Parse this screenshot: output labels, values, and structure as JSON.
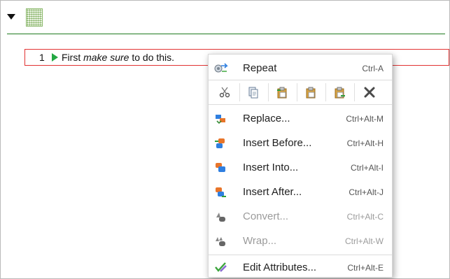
{
  "document": {
    "item": {
      "number": "1",
      "text_before": "First ",
      "text_emphasis": "make sure",
      "text_after": " to do this."
    }
  },
  "context_menu": {
    "repeat": {
      "label": "Repeat",
      "shortcut": "Ctrl-A",
      "icon": "repeat-icon"
    },
    "toolbar": [
      {
        "name": "cut",
        "icon": "scissors-icon"
      },
      {
        "name": "copy",
        "icon": "copy-icon"
      },
      {
        "name": "paste-before",
        "icon": "paste-before-icon"
      },
      {
        "name": "paste",
        "icon": "paste-icon"
      },
      {
        "name": "paste-after",
        "icon": "paste-after-icon"
      },
      {
        "name": "delete",
        "icon": "delete-icon"
      }
    ],
    "items": [
      {
        "label": "Replace...",
        "shortcut": "Ctrl+Alt-M",
        "enabled": true,
        "icon": "replace-icon"
      },
      {
        "label": "Insert Before...",
        "shortcut": "Ctrl+Alt-H",
        "enabled": true,
        "icon": "insert-before-icon"
      },
      {
        "label": "Insert Into...",
        "shortcut": "Ctrl+Alt-I",
        "enabled": true,
        "icon": "insert-into-icon"
      },
      {
        "label": "Insert After...",
        "shortcut": "Ctrl+Alt-J",
        "enabled": true,
        "icon": "insert-after-icon"
      },
      {
        "label": "Convert...",
        "shortcut": "Ctrl+Alt-C",
        "enabled": false,
        "icon": "convert-icon"
      },
      {
        "label": "Wrap...",
        "shortcut": "Ctrl+Alt-W",
        "enabled": false,
        "icon": "wrap-icon"
      }
    ],
    "edit_attributes": {
      "label": "Edit Attributes...",
      "shortcut": "Ctrl+Alt-E",
      "icon": "edit-attributes-icon"
    }
  },
  "colors": {
    "header_rule": "#1f7a1f",
    "item_border": "#e23333",
    "play_icon": "#23a843",
    "disabled_text": "#9b9b9b"
  }
}
